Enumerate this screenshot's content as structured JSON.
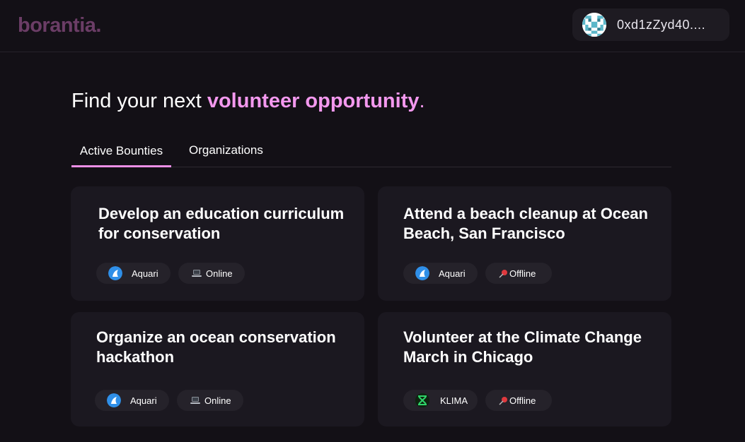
{
  "app": {
    "logo": "borantia."
  },
  "wallet": {
    "address": "0xd1zZyd40...."
  },
  "hero": {
    "prefix": "Find your next ",
    "accent": "volunteer opportunity",
    "suffix": "."
  },
  "tabs": [
    {
      "label": "Active Bounties",
      "active": true
    },
    {
      "label": "Organizations",
      "active": false
    }
  ],
  "colors": {
    "background": "#131016",
    "card": "#1b1820",
    "accent": "#f398ee",
    "logo": "#6b3d66"
  },
  "bounties": [
    {
      "title": "Develop an education curriculum for conservation",
      "org": "Aquari",
      "org_icon": "aquari-fin-icon",
      "mode": "Online",
      "mode_icon": "laptop-icon"
    },
    {
      "title": "Attend a beach cleanup at Ocean Beach, San Francisco",
      "org": "Aquari",
      "org_icon": "aquari-fin-icon",
      "mode": "Offline",
      "mode_icon": "pushpin-icon"
    },
    {
      "title": "Organize an ocean conservation hackathon",
      "org": "Aquari",
      "org_icon": "aquari-fin-icon",
      "mode": "Online",
      "mode_icon": "laptop-icon"
    },
    {
      "title": "Volunteer at the Climate Change March in Chicago",
      "org": "KLIMA",
      "org_icon": "klima-logo-icon",
      "mode": "Offline",
      "mode_icon": "pushpin-icon"
    }
  ]
}
